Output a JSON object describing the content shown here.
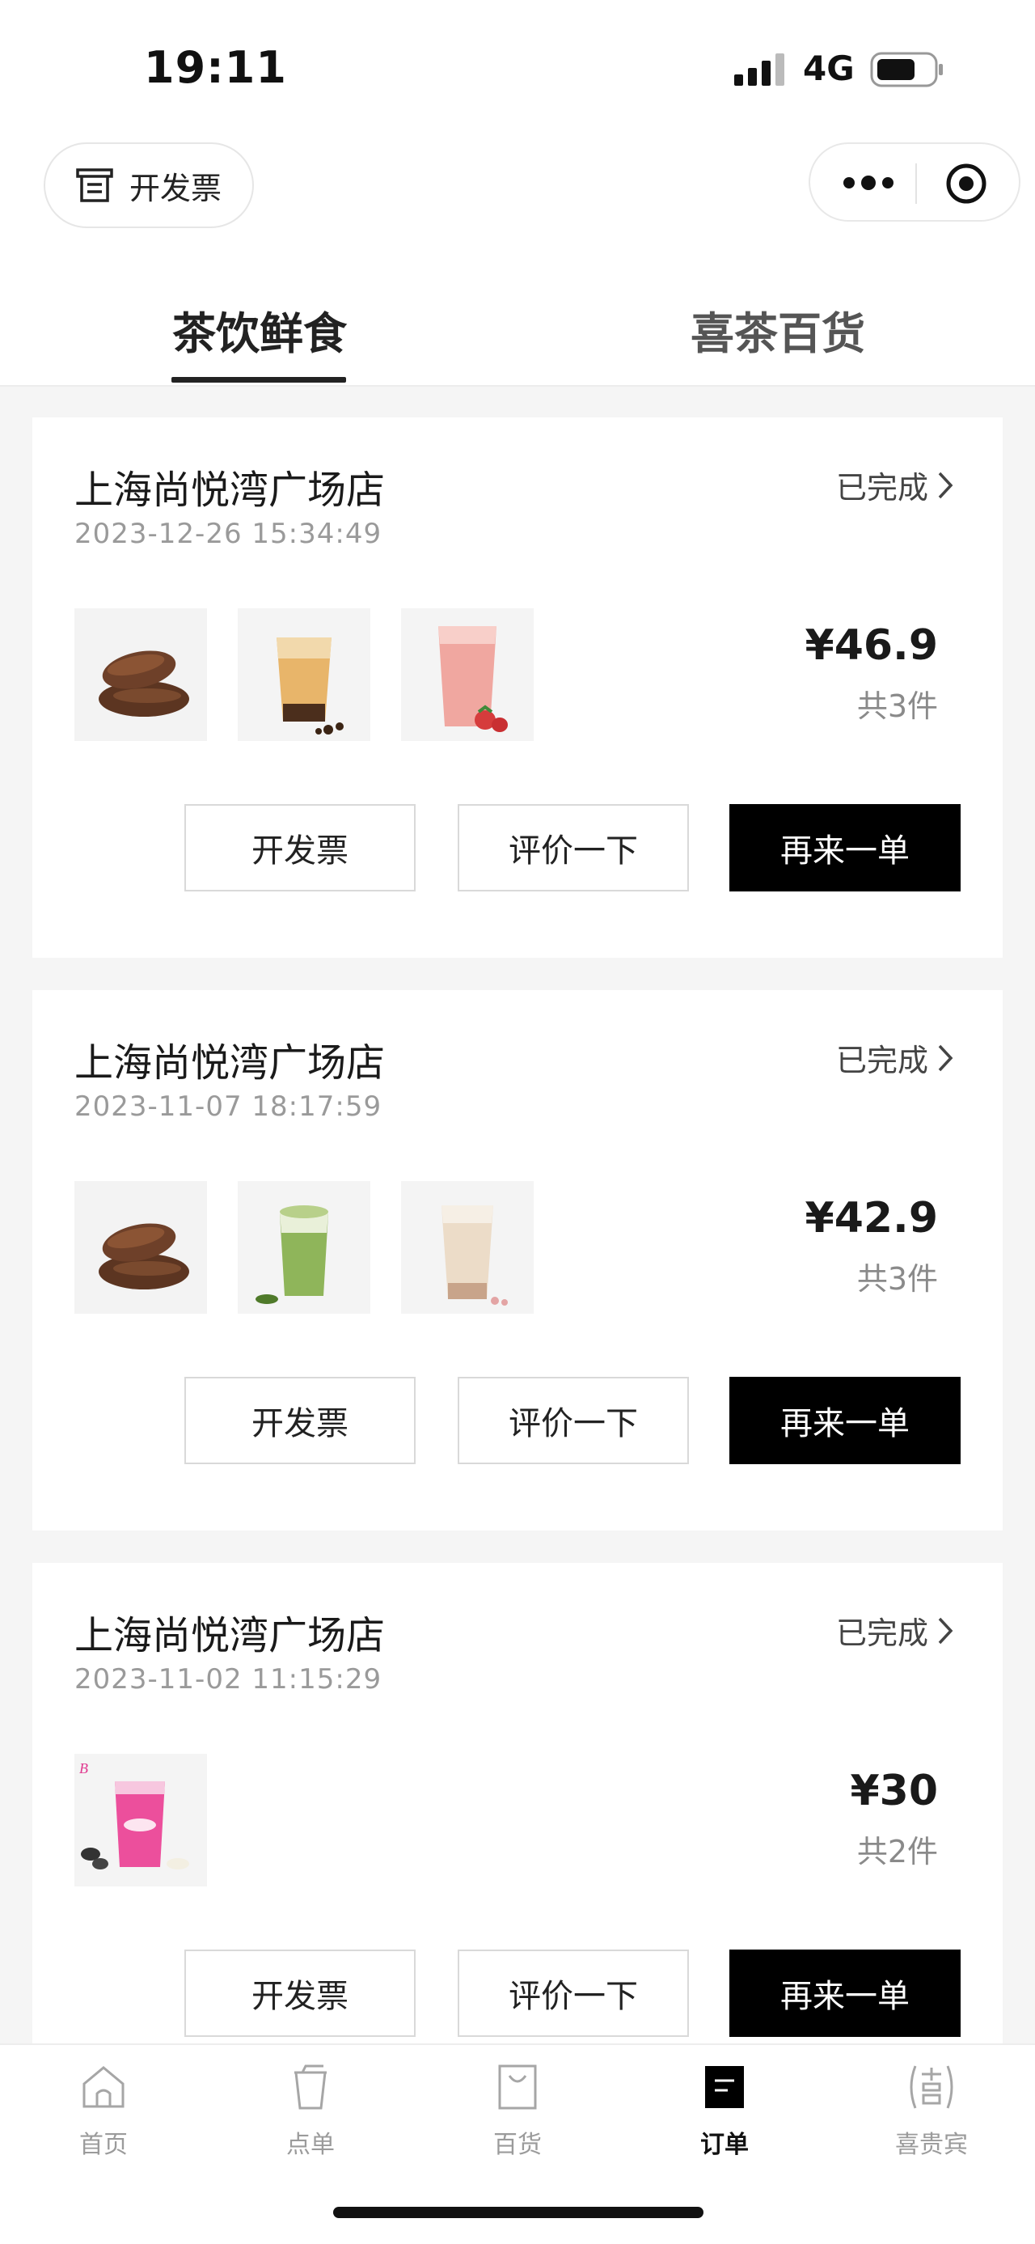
{
  "status_bar": {
    "time": "19:11",
    "network": "4G"
  },
  "header": {
    "invoice_label": "开发票"
  },
  "tabs": [
    {
      "label": "茶饮鲜食",
      "active": true
    },
    {
      "label": "喜茶百货",
      "active": false
    }
  ],
  "orders": [
    {
      "store": "上海尚悦湾广场店",
      "status": "已完成",
      "time": "2023-12-26 15:34:49",
      "price": "¥46.9",
      "count": "共3件",
      "items": [
        "chocolate-eclair-pastry",
        "brown-boba-milk-tea",
        "strawberry-drink"
      ],
      "buttons": {
        "invoice": "开发票",
        "review": "评价一下",
        "reorder": "再来一单"
      }
    },
    {
      "store": "上海尚悦湾广场店",
      "status": "已完成",
      "time": "2023-11-07 18:17:59",
      "price": "¥42.9",
      "count": "共3件",
      "items": [
        "chocolate-eclair-pastry",
        "matcha-drink",
        "boba-milk-tea"
      ],
      "buttons": {
        "invoice": "开发票",
        "review": "评价一下",
        "reorder": "再来一单"
      }
    },
    {
      "store": "上海尚悦湾广场店",
      "status": "已完成",
      "time": "2023-11-02 11:15:29",
      "price": "¥30",
      "count": "共2件",
      "items": [
        "barbie-pink-drink"
      ],
      "buttons": {
        "invoice": "开发票",
        "review": "评价一下",
        "reorder": "再来一单"
      }
    }
  ],
  "bottom_nav": [
    {
      "label": "首页",
      "icon": "home-icon",
      "active": false
    },
    {
      "label": "点单",
      "icon": "cup-icon",
      "active": false
    },
    {
      "label": "百货",
      "icon": "shopping-bag-icon",
      "active": false
    },
    {
      "label": "订单",
      "icon": "order-icon",
      "active": true
    },
    {
      "label": "喜贵宾",
      "icon": "vip-icon",
      "active": false
    }
  ],
  "colors": {
    "primary": "#000000",
    "text": "#222222",
    "muted": "#9a9a9a",
    "background": "#f5f5f5"
  }
}
